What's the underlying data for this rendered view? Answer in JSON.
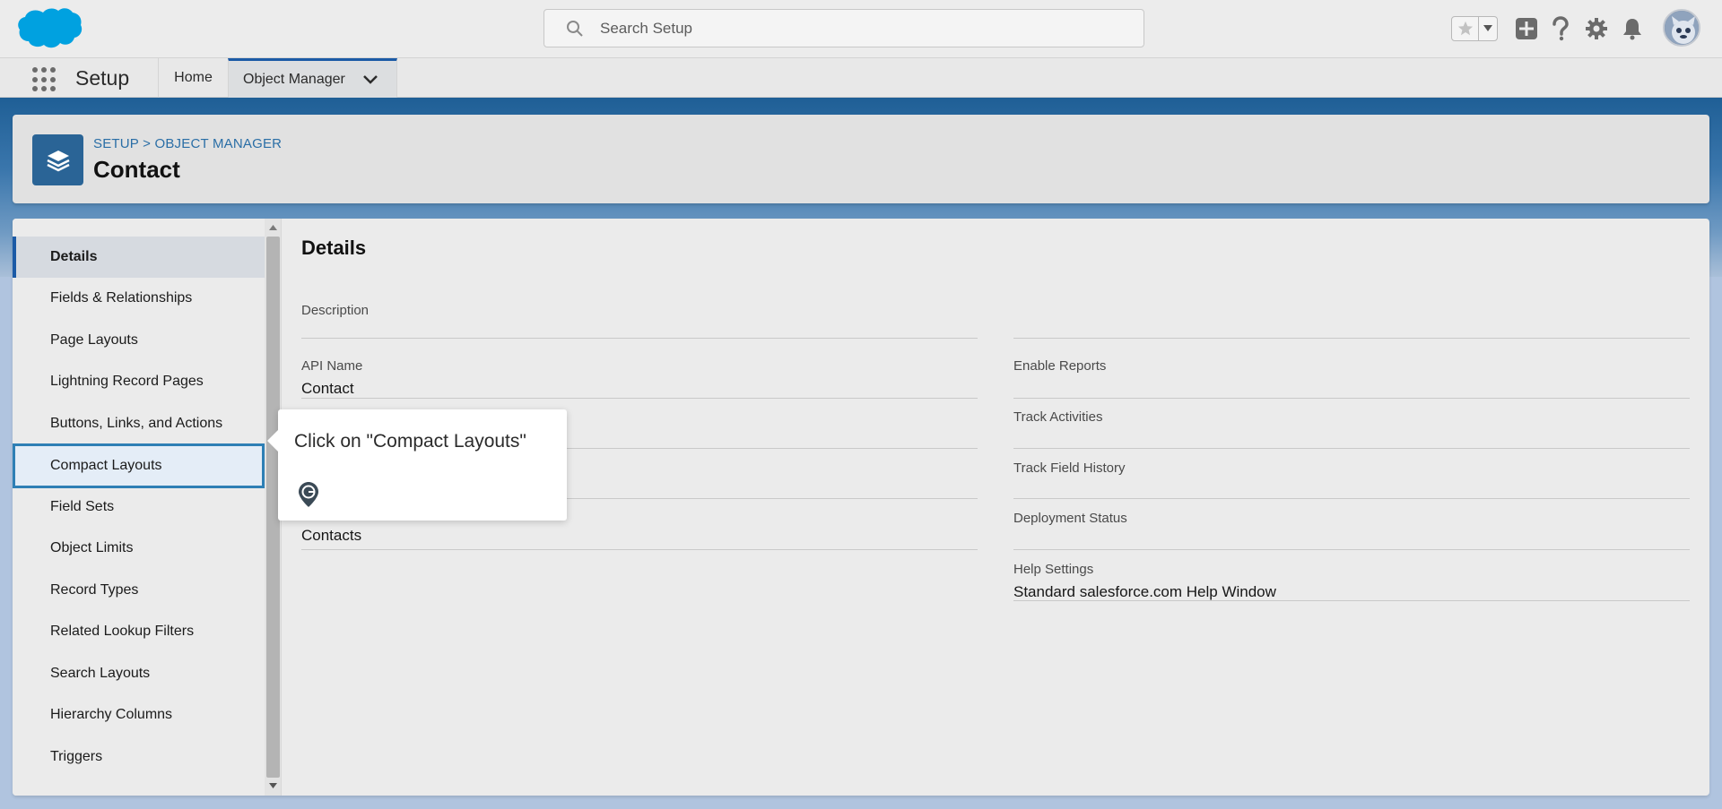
{
  "header": {
    "search_placeholder": "Search Setup",
    "icons": [
      "salesforce-logo",
      "search-icon",
      "favorites-star-icon",
      "favorites-dropdown-icon",
      "add-icon",
      "help-icon",
      "gear-icon",
      "bell-icon",
      "avatar"
    ]
  },
  "nav": {
    "app_name": "Setup",
    "home_label": "Home",
    "object_manager_label": "Object Manager"
  },
  "page_header": {
    "breadcrumb_setup": "SETUP",
    "breadcrumb_separator": ">",
    "breadcrumb_object_manager": "OBJECT MANAGER",
    "title": "Contact"
  },
  "sidebar": {
    "items": [
      {
        "label": "Details"
      },
      {
        "label": "Fields & Relationships"
      },
      {
        "label": "Page Layouts"
      },
      {
        "label": "Lightning Record Pages"
      },
      {
        "label": "Buttons, Links, and Actions"
      },
      {
        "label": "Compact Layouts"
      },
      {
        "label": "Field Sets"
      },
      {
        "label": "Object Limits"
      },
      {
        "label": "Record Types"
      },
      {
        "label": "Related Lookup Filters"
      },
      {
        "label": "Search Layouts"
      },
      {
        "label": "Hierarchy Columns"
      },
      {
        "label": "Triggers"
      }
    ]
  },
  "details": {
    "title": "Details",
    "description_label": "Description",
    "api_name_label": "API Name",
    "api_name_value": "Contact",
    "plural_label_value": "Contacts",
    "enable_reports_label": "Enable Reports",
    "track_activities_label": "Track Activities",
    "track_field_history_label": "Track Field History",
    "deployment_status_label": "Deployment Status",
    "help_settings_label": "Help Settings",
    "help_settings_value": "Standard salesforce.com Help Window"
  },
  "tooltip": {
    "text": "Click on \"Compact Layouts\""
  },
  "colors": {
    "brand_blue": "#1b5aa6",
    "salesforce_cloud": "#00a1e0",
    "object_icon": "#2a6496",
    "highlight_border": "#2e7fb5"
  }
}
